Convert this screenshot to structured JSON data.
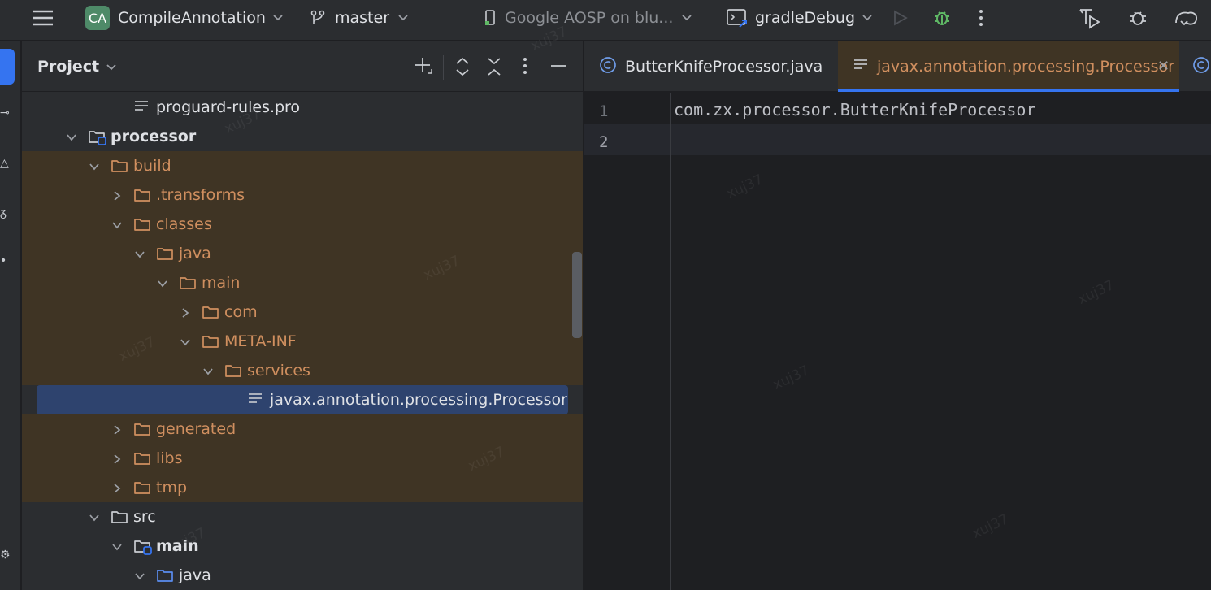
{
  "topbar": {
    "project_badge": "CA",
    "project_name": "CompileAnnotation",
    "branch": "master",
    "device": "Google AOSP on blu...",
    "run_config": "gradleDebug"
  },
  "project_panel": {
    "title": "Project"
  },
  "tree": [
    {
      "label": "proguard-rules.pro",
      "type": "file",
      "depth": 3,
      "expanded": null,
      "excluded": false
    },
    {
      "label": "processor",
      "type": "module",
      "depth": 1,
      "expanded": true,
      "excluded": false,
      "bold": true
    },
    {
      "label": "build",
      "type": "folder",
      "depth": 2,
      "expanded": true,
      "excluded": true
    },
    {
      "label": ".transforms",
      "type": "folder",
      "depth": 3,
      "expanded": false,
      "excluded": true
    },
    {
      "label": "classes",
      "type": "folder",
      "depth": 3,
      "expanded": true,
      "excluded": true
    },
    {
      "label": "java",
      "type": "folder",
      "depth": 4,
      "expanded": true,
      "excluded": true
    },
    {
      "label": "main",
      "type": "folder",
      "depth": 5,
      "expanded": true,
      "excluded": true
    },
    {
      "label": "com",
      "type": "folder",
      "depth": 6,
      "expanded": false,
      "excluded": true
    },
    {
      "label": "META-INF",
      "type": "folder",
      "depth": 6,
      "expanded": true,
      "excluded": true
    },
    {
      "label": "services",
      "type": "folder",
      "depth": 7,
      "expanded": true,
      "excluded": true
    },
    {
      "label": "javax.annotation.processing.Processor",
      "type": "file",
      "depth": 8,
      "expanded": null,
      "excluded": true,
      "selected": true
    },
    {
      "label": "generated",
      "type": "folder",
      "depth": 3,
      "expanded": false,
      "excluded": true
    },
    {
      "label": "libs",
      "type": "folder",
      "depth": 3,
      "expanded": false,
      "excluded": true
    },
    {
      "label": "tmp",
      "type": "folder",
      "depth": 3,
      "expanded": false,
      "excluded": true
    },
    {
      "label": "src",
      "type": "folder",
      "depth": 2,
      "expanded": true,
      "excluded": false
    },
    {
      "label": "main",
      "type": "module-folder",
      "depth": 3,
      "expanded": true,
      "excluded": false,
      "bold": true
    },
    {
      "label": "java",
      "type": "source-folder",
      "depth": 4,
      "expanded": true,
      "excluded": false
    }
  ],
  "editor": {
    "tabs": [
      {
        "label": "ButterKnifeProcessor.java",
        "icon": "class-icon",
        "active": false
      },
      {
        "label": "javax.annotation.processing.Processor",
        "icon": "text-file-icon",
        "active": true
      },
      {
        "label": "",
        "icon": "class-icon",
        "active": false
      }
    ],
    "lines": [
      {
        "number": "1",
        "text": "com.zx.processor.ButterKnifeProcessor"
      },
      {
        "number": "2",
        "text": ""
      }
    ]
  },
  "watermark": "xuj37",
  "colors": {
    "accent": "#3574f0",
    "excluded_bg": "#3f3424",
    "excluded_text": "#d08f5f",
    "selection_bg": "#2e436e",
    "debug_green": "#5fb865"
  }
}
